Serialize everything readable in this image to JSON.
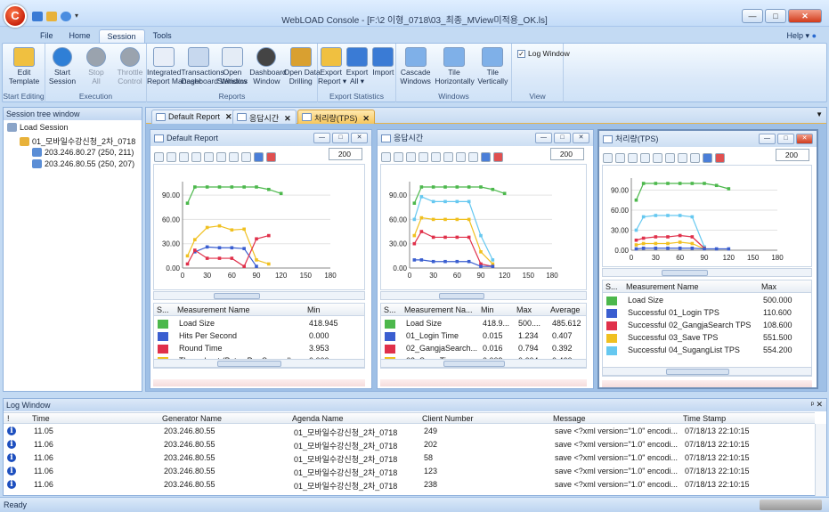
{
  "app": {
    "title": "WebLOAD Console - [F:\\2 이형_0718\\03_최종_MView미적용_OK.ls]",
    "help": "Help",
    "logo": "C"
  },
  "menu_tabs": [
    "File",
    "Home",
    "Session",
    "Tools"
  ],
  "ribbon": {
    "groups": [
      {
        "label": "Start Editing",
        "buttons": [
          {
            "label": "Edit\nTemplate"
          }
        ]
      },
      {
        "label": "Execution",
        "buttons": [
          {
            "label": "Start\nSession"
          },
          {
            "label": "Stop\nAll"
          },
          {
            "label": "Throttle\nControl"
          }
        ]
      },
      {
        "label": "Reports",
        "buttons": [
          {
            "label": "Integrated\nReport Manager"
          },
          {
            "label": "Transactions\nDashboard Window"
          },
          {
            "label": "Open\nStatistics"
          },
          {
            "label": "Dashboard\nWindow"
          },
          {
            "label": "Open Data\nDrilling"
          }
        ]
      },
      {
        "label": "Export Statistics",
        "buttons": [
          {
            "label": "Export\nReport ▾"
          },
          {
            "label": "Export\nAll ▾"
          },
          {
            "label": "Import"
          }
        ]
      },
      {
        "label": "Windows",
        "buttons": [
          {
            "label": "Cascade\nWindows"
          },
          {
            "label": "Tile\nHorizontally"
          },
          {
            "label": "Tile\nVertically"
          }
        ]
      },
      {
        "label": "View",
        "checkbox": "Log Window"
      }
    ]
  },
  "tree": {
    "title": "Session tree window",
    "root": "Load Session",
    "child": "01_모바일수강신청_2차_0718",
    "hosts": [
      "203.246.80.27 (250, 211)",
      "203.246.80.55 (250, 207)"
    ]
  },
  "doc_tabs": [
    "Default Report",
    "응답시간",
    "처리량(TPS)"
  ],
  "reports": [
    {
      "title": "Default Report",
      "spin": "200",
      "chart": {
        "type": "line",
        "yticks": [
          "90.00",
          "60.00",
          "30.00",
          "0.00"
        ],
        "xticks": [
          "0",
          "30",
          "60",
          "90",
          "120",
          "150",
          "180"
        ],
        "xlim": [
          0,
          180
        ],
        "ylim": [
          0,
          100
        ],
        "series": [
          {
            "color": "#4cb84c",
            "x": [
              6,
              15,
              30,
              45,
              60,
              75,
              90,
              105,
              120
            ],
            "y": [
              80,
              100,
              100,
              100,
              100,
              100,
              100,
              97,
              92
            ]
          },
          {
            "color": "#f0c020",
            "x": [
              6,
              15,
              30,
              45,
              60,
              75,
              90,
              105
            ],
            "y": [
              15,
              35,
              50,
              52,
              47,
              48,
              10,
              5
            ]
          },
          {
            "color": "#3a5ed0",
            "x": [
              15,
              30,
              45,
              60,
              75,
              90
            ],
            "y": [
              20,
              26,
              25,
              25,
              24,
              2
            ]
          },
          {
            "color": "#e0304a",
            "x": [
              6,
              15,
              30,
              45,
              60,
              75,
              90,
              105
            ],
            "y": [
              5,
              22,
              12,
              12,
              12,
              2,
              36,
              40
            ]
          }
        ]
      },
      "table": {
        "cols": [
          "S...",
          "Measurement Name",
          "Min"
        ],
        "rows": [
          {
            "color": "#4cb84c",
            "name": "Load Size",
            "v": [
              "418.945"
            ]
          },
          {
            "color": "#3a5ed0",
            "name": "Hits Per Second",
            "v": [
              "0.000"
            ]
          },
          {
            "color": "#e0304a",
            "name": "Round Time",
            "v": [
              "3.953"
            ]
          },
          {
            "color": "#f0c020",
            "name": "Throughput (Bytes Per Second)",
            "v": [
              "0.000"
            ]
          }
        ]
      }
    },
    {
      "title": "응답시간",
      "spin": "200",
      "chart": {
        "type": "line",
        "yticks": [
          "90.00",
          "60.00",
          "30.00",
          "0.00"
        ],
        "xticks": [
          "0",
          "30",
          "60",
          "90",
          "120",
          "150",
          "180"
        ],
        "xlim": [
          0,
          180
        ],
        "ylim": [
          0,
          100
        ],
        "series": [
          {
            "color": "#4cb84c",
            "x": [
              6,
              15,
              30,
              45,
              60,
              75,
              90,
              105,
              120
            ],
            "y": [
              80,
              100,
              100,
              100,
              100,
              100,
              100,
              97,
              92
            ]
          },
          {
            "color": "#66c8f0",
            "x": [
              6,
              15,
              30,
              45,
              60,
              75,
              90,
              105
            ],
            "y": [
              60,
              88,
              82,
              82,
              82,
              82,
              40,
              10
            ]
          },
          {
            "color": "#f0c020",
            "x": [
              6,
              15,
              30,
              45,
              60,
              75,
              90,
              105
            ],
            "y": [
              40,
              62,
              60,
              60,
              60,
              60,
              20,
              5
            ]
          },
          {
            "color": "#e0304a",
            "x": [
              6,
              15,
              30,
              45,
              60,
              75,
              90,
              105
            ],
            "y": [
              30,
              45,
              38,
              38,
              38,
              38,
              5,
              2
            ]
          },
          {
            "color": "#3a5ed0",
            "x": [
              6,
              15,
              30,
              45,
              60,
              75,
              90,
              105
            ],
            "y": [
              10,
              10,
              8,
              8,
              8,
              8,
              2,
              2
            ]
          }
        ]
      },
      "table": {
        "cols": [
          "S...",
          "Measurement Na...",
          "Min",
          "Max",
          "Average"
        ],
        "rows": [
          {
            "color": "#4cb84c",
            "name": "Load Size",
            "v": [
              "418.9...",
              "500....",
              "485.612"
            ]
          },
          {
            "color": "#3a5ed0",
            "name": "01_Login Time",
            "v": [
              "0.015",
              "1.234",
              "0.407"
            ]
          },
          {
            "color": "#e0304a",
            "name": "02_GangjaSearch...",
            "v": [
              "0.016",
              "0.794",
              "0.392"
            ]
          },
          {
            "color": "#f0c020",
            "name": "03_Save Time",
            "v": [
              "0.009",
              "0.604",
              "0.460"
            ]
          }
        ]
      }
    },
    {
      "title": "처리량(TPS)",
      "spin": "200",
      "chart": {
        "type": "line",
        "yticks": [
          "90.00",
          "60.00",
          "30.00",
          "0.00"
        ],
        "xticks": [
          "0",
          "30",
          "60",
          "90",
          "120",
          "150",
          "180"
        ],
        "xlim": [
          0,
          180
        ],
        "ylim": [
          0,
          100
        ],
        "series": [
          {
            "color": "#4cb84c",
            "x": [
              6,
              15,
              30,
              45,
              60,
              75,
              90,
              105,
              120
            ],
            "y": [
              75,
              100,
              100,
              100,
              100,
              100,
              100,
              97,
              92
            ]
          },
          {
            "color": "#66c8f0",
            "x": [
              6,
              15,
              30,
              45,
              60,
              75,
              90
            ],
            "y": [
              30,
              50,
              52,
              52,
              52,
              50,
              5
            ]
          },
          {
            "color": "#e0304a",
            "x": [
              6,
              15,
              30,
              45,
              60,
              75,
              90
            ],
            "y": [
              15,
              18,
              20,
              20,
              22,
              20,
              3
            ]
          },
          {
            "color": "#f0c020",
            "x": [
              6,
              15,
              30,
              45,
              60,
              75,
              90
            ],
            "y": [
              8,
              10,
              10,
              10,
              12,
              10,
              2
            ]
          },
          {
            "color": "#3a5ed0",
            "x": [
              6,
              15,
              30,
              45,
              60,
              75,
              90,
              105,
              120
            ],
            "y": [
              2,
              3,
              3,
              3,
              3,
              3,
              2,
              2,
              2
            ]
          }
        ]
      },
      "table": {
        "cols": [
          "S...",
          "Measurement Name",
          "Max"
        ],
        "rows": [
          {
            "color": "#4cb84c",
            "name": "Load Size",
            "v": [
              "500.000"
            ]
          },
          {
            "color": "#3a5ed0",
            "name": "Successful 01_Login TPS",
            "v": [
              "110.600"
            ]
          },
          {
            "color": "#e0304a",
            "name": "Successful 02_GangjaSearch TPS",
            "v": [
              "108.600"
            ]
          },
          {
            "color": "#f0c020",
            "name": "Successful 03_Save TPS",
            "v": [
              "551.500"
            ]
          },
          {
            "color": "#66c8f0",
            "name": "Successful 04_SugangList TPS",
            "v": [
              "554.200"
            ]
          }
        ]
      }
    }
  ],
  "log": {
    "title": "Log Window",
    "cols": [
      "!",
      "",
      "Time",
      "Generator Name",
      "Agenda Name",
      "Client Number",
      "Message",
      "Time Stamp"
    ],
    "rows": [
      [
        "11.05",
        "203.246.80.55",
        "01_모바일수강신청_2차_0718",
        "249",
        "save  <?xml version=\"1.0\" encodi...",
        "07/18/13 22:10:15"
      ],
      [
        "11.06",
        "203.246.80.55",
        "01_모바일수강신청_2차_0718",
        "202",
        "save  <?xml version=\"1.0\" encodi...",
        "07/18/13 22:10:15"
      ],
      [
        "11.06",
        "203.246.80.55",
        "01_모바일수강신청_2차_0718",
        "58",
        "save  <?xml version=\"1.0\" encodi...",
        "07/18/13 22:10:15"
      ],
      [
        "11.06",
        "203.246.80.55",
        "01_모바일수강신청_2차_0718",
        "123",
        "save  <?xml version=\"1.0\" encodi...",
        "07/18/13 22:10:15"
      ],
      [
        "11.06",
        "203.246.80.55",
        "01_모바일수강신청_2차_0718",
        "238",
        "save  <?xml version=\"1.0\" encodi...",
        "07/18/13 22:10:15"
      ]
    ]
  },
  "status": "Ready"
}
